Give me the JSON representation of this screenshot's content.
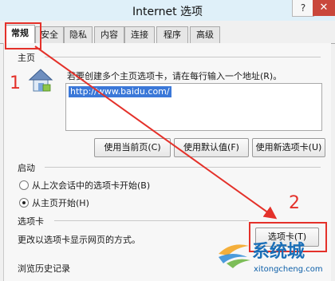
{
  "window": {
    "title": "Internet 选项",
    "help_label": "?",
    "close_label": "✕"
  },
  "tabs": [
    {
      "label": "常规"
    },
    {
      "label": "安全"
    },
    {
      "label": "隐私"
    },
    {
      "label": "内容"
    },
    {
      "label": "连接"
    },
    {
      "label": "程序"
    },
    {
      "label": "高级"
    }
  ],
  "homepage": {
    "heading": "主页",
    "description": "若要创建多个主页选项卡，请在每行输入一个地址(R)。",
    "url": "http://www.baidu.com/",
    "icon": "home-page-icon",
    "buttons": {
      "use_current": "使用当前页(C)",
      "use_default": "使用默认值(F)",
      "use_new_tab": "使用新选项卡(U)"
    }
  },
  "startup": {
    "heading": "启动",
    "options": [
      {
        "label": "从上次会话中的选项卡开始(B)",
        "selected": false
      },
      {
        "label": "从主页开始(H)",
        "selected": true
      }
    ]
  },
  "tabs_section": {
    "heading": "选项卡",
    "description": "更改以选项卡显示网页的方式。",
    "button_label": "选项卡(T)"
  },
  "history": {
    "heading": "浏览历史记录"
  },
  "annotations": {
    "step1": "1",
    "step2": "2",
    "color": "#e4312a"
  },
  "watermark": {
    "brand": "系统城",
    "url": "xitongcheng.com"
  }
}
